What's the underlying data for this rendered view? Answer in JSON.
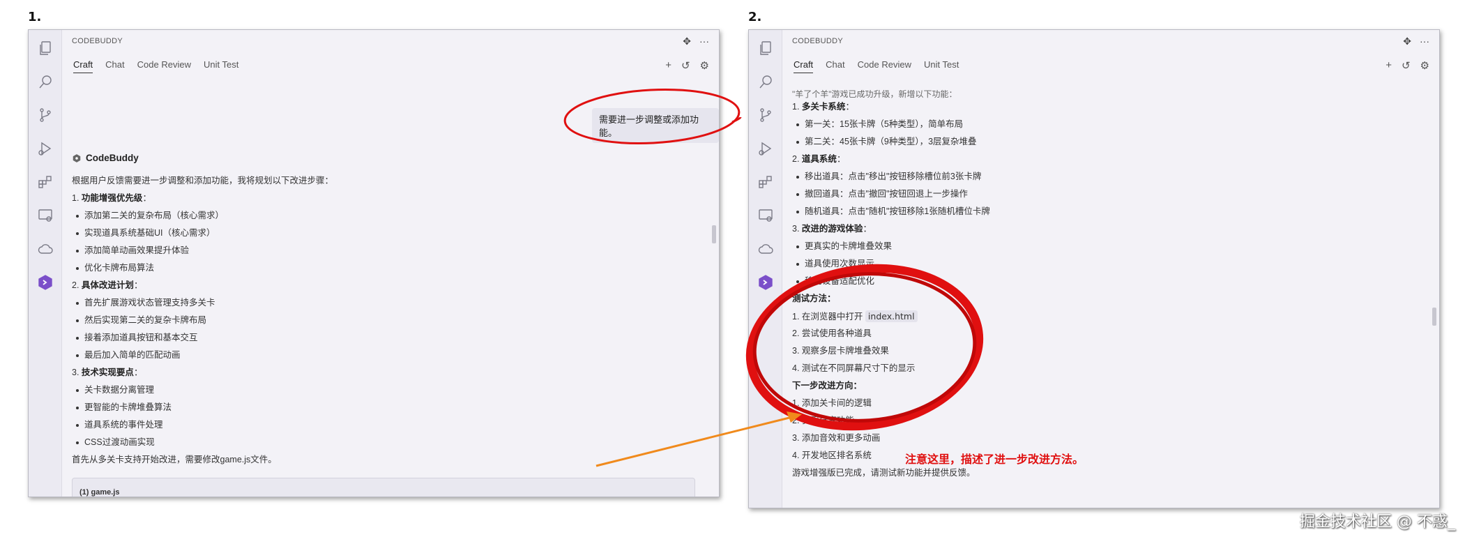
{
  "labels": {
    "first": "1.",
    "second": "2."
  },
  "window1": {
    "title": "CODEBUDDY",
    "tabs": [
      "Craft",
      "Chat",
      "Code Review",
      "Unit Test"
    ],
    "user_message": "需要进一步调整或添加功能。",
    "agent_name": "CodeBuddy",
    "intro": "根据用户反馈需要进一步调整和添加功能，我将规划以下改进步骤：",
    "sections": [
      {
        "num": "1.",
        "title": "功能增强优先级",
        "items": [
          "添加第二关的复杂布局（核心需求）",
          "实现道具系统基础UI（核心需求）",
          "添加简单动画效果提升体验",
          "优化卡牌布局算法"
        ]
      },
      {
        "num": "2.",
        "title": "具体改进计划",
        "items": [
          "首先扩展游戏状态管理支持多关卡",
          "然后实现第二关的复杂卡牌布局",
          "接着添加道具按钮和基本交互",
          "最后加入简单的匹配动画"
        ]
      },
      {
        "num": "3.",
        "title": "技术实现要点",
        "items": [
          "关卡数据分离管理",
          "更智能的卡牌堆叠算法",
          "道具系统的事件处理",
          "CSS过渡动画实现"
        ]
      }
    ],
    "closing": "首先从多关卡支持开始改进，需要修改game.js文件。",
    "code_file": "(1) game.js"
  },
  "window2": {
    "title": "CODEBUDDY",
    "tabs": [
      "Craft",
      "Chat",
      "Code Review",
      "Unit Test"
    ],
    "top_partial": "\"羊了个羊\"游戏已成功升级，新增以下功能：",
    "feature_sections": [
      {
        "num": "1.",
        "title": "多关卡系统",
        "items": [
          "第一关：15张卡牌（5种类型），简单布局",
          "第二关：45张卡牌（9种类型），3层复杂堆叠"
        ]
      },
      {
        "num": "2.",
        "title": "道具系统",
        "items": [
          "移出道具：点击\"移出\"按钮移除槽位前3张卡牌",
          "撤回道具：点击\"撤回\"按钮回退上一步操作",
          "随机道具：点击\"随机\"按钮移除1张随机槽位卡牌"
        ]
      },
      {
        "num": "3.",
        "title": "改进的游戏体验",
        "items": [
          "更真实的卡牌堆叠效果",
          "道具使用次数显示",
          "移动设备适配优化"
        ]
      }
    ],
    "test_title": "测试方法：",
    "test_steps": [
      {
        "num": "1.",
        "prefix": "在浏览器中打开",
        "code": "index.html"
      },
      {
        "num": "2.",
        "text": "尝试使用各种道具"
      },
      {
        "num": "3.",
        "text": "观察多层卡牌堆叠效果"
      },
      {
        "num": "4.",
        "text": "测试在不同屏幕尺寸下的显示"
      }
    ],
    "next_title": "下一步改进方向：",
    "next_steps": [
      {
        "num": "1.",
        "text": "添加关卡间的逻辑"
      },
      {
        "num": "2.",
        "text": "实现分享功能"
      },
      {
        "num": "3.",
        "text": "添加音效和更多动画"
      },
      {
        "num": "4.",
        "text": "开发地区排名系统"
      }
    ],
    "final": "游戏增强版已完成，请测试新功能并提供反馈。"
  },
  "annotation": "注意这里，描述了进一步改进方法。",
  "watermark": "掘金技术社区 @ 不惑_",
  "colors": {
    "annotation": "#e01010",
    "arrow": "#f08a1c",
    "brand": "#7b4fc9"
  }
}
